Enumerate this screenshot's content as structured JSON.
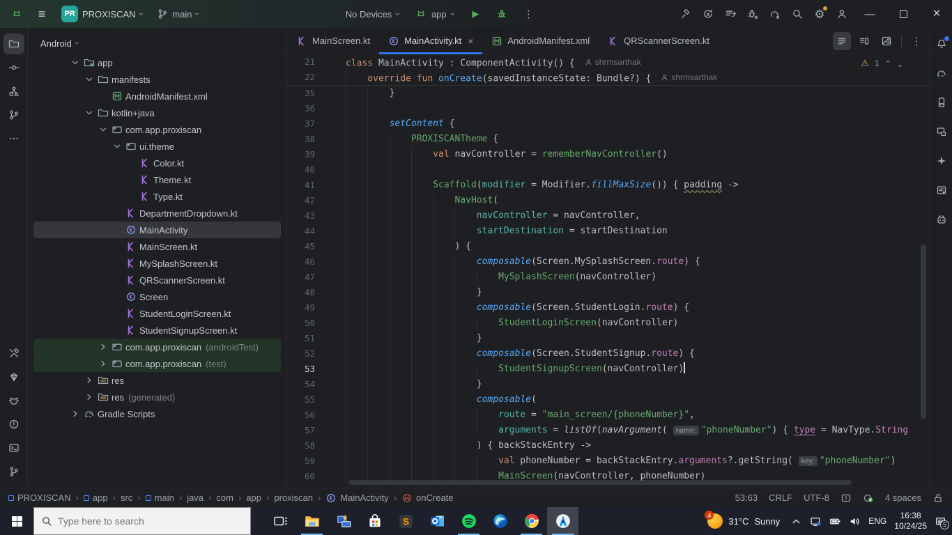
{
  "title_bar": {
    "project_badge": "PR",
    "project_name": "PROXISCAN",
    "branch_name": "main",
    "device_selector": "No Devices",
    "run_config": "app",
    "right_icons": [
      "build",
      "sync",
      "task-list",
      "attach-debugger",
      "gradle-sync",
      "search",
      "settings",
      "account"
    ]
  },
  "left_stripe": {
    "top": [
      {
        "name": "project",
        "selected": true
      },
      {
        "name": "commit"
      },
      {
        "name": "structure"
      },
      {
        "name": "pull-requests"
      },
      {
        "name": "more"
      }
    ],
    "bottom": [
      {
        "name": "build-tools"
      },
      {
        "name": "gemini"
      },
      {
        "name": "logcat"
      },
      {
        "name": "problems"
      },
      {
        "name": "terminal"
      },
      {
        "name": "version-control"
      }
    ]
  },
  "right_stripe": [
    {
      "name": "notifications",
      "badge": true
    },
    {
      "name": "gradle"
    },
    {
      "name": "device-manager"
    },
    {
      "name": "running-devices"
    },
    {
      "name": "gemini-sparkle"
    },
    {
      "name": "assistant"
    },
    {
      "name": "app-insights"
    }
  ],
  "project_panel": {
    "view_selector": "Android",
    "tree": [
      {
        "label": "app",
        "level": 1,
        "chevron": "down",
        "icon": "folder-app"
      },
      {
        "label": "manifests",
        "level": 2,
        "chevron": "down",
        "icon": "folder"
      },
      {
        "label": "AndroidManifest.xml",
        "level": 3,
        "icon": "file-manifest"
      },
      {
        "label": "kotlin+java",
        "level": 2,
        "chevron": "down",
        "icon": "folder"
      },
      {
        "label": "com.app.proxiscan",
        "level": 3,
        "chevron": "down",
        "icon": "package"
      },
      {
        "label": "ui.theme",
        "level": 4,
        "chevron": "down",
        "icon": "package"
      },
      {
        "label": "Color.kt",
        "level": 5,
        "icon": "file-kotlin"
      },
      {
        "label": "Theme.kt",
        "level": 5,
        "icon": "file-kotlin"
      },
      {
        "label": "Type.kt",
        "level": 5,
        "icon": "file-kotlin"
      },
      {
        "label": "DepartmentDropdown.kt",
        "level": 4,
        "icon": "file-kotlin"
      },
      {
        "label": "MainActivity",
        "level": 4,
        "icon": "class-kotlin",
        "selected": true
      },
      {
        "label": "MainScreen.kt",
        "level": 4,
        "icon": "file-kotlin"
      },
      {
        "label": "MySplashScreen.kt",
        "level": 4,
        "icon": "file-kotlin"
      },
      {
        "label": "QRScannerScreen.kt",
        "level": 4,
        "icon": "file-kotlin"
      },
      {
        "label": "Screen",
        "level": 4,
        "icon": "class-kotlin"
      },
      {
        "label": "StudentLoginScreen.kt",
        "level": 4,
        "icon": "file-kotlin"
      },
      {
        "label": "StudentSignupScreen.kt",
        "level": 4,
        "icon": "file-kotlin"
      },
      {
        "label": "com.app.proxiscan",
        "suffix": "(androidTest)",
        "level": 3,
        "chevron": "right",
        "icon": "package",
        "tint": true
      },
      {
        "label": "com.app.proxiscan",
        "suffix": "(test)",
        "level": 3,
        "chevron": "right",
        "icon": "package",
        "tint": true
      },
      {
        "label": "res",
        "level": 2,
        "chevron": "right",
        "icon": "folder-res"
      },
      {
        "label": "res",
        "suffix": "(generated)",
        "level": 2,
        "chevron": "right",
        "icon": "folder-res"
      },
      {
        "label": "Gradle Scripts",
        "level": 1,
        "chevron": "right",
        "icon": "gradle"
      }
    ]
  },
  "editor": {
    "tabs": [
      {
        "label": "MainScreen.kt",
        "icon": "file-kotlin"
      },
      {
        "label": "MainActivity.kt",
        "icon": "class-kotlin",
        "active": true,
        "close": "×"
      },
      {
        "label": "AndroidManifest.xml",
        "icon": "file-manifest"
      },
      {
        "label": "QRScannerScreen.kt",
        "icon": "file-kotlin"
      }
    ],
    "view_modes": [
      "code-view",
      "split-view",
      "design-view"
    ],
    "warning_count": "1",
    "sticky_lines": [
      {
        "n": "21",
        "ind": 0,
        "seg": [
          [
            "k",
            "class "
          ],
          [
            "p",
            "MainActivity : ComponentActivity() {"
          ]
        ],
        "author": "shrmsarthak"
      },
      {
        "n": "22",
        "ind": 4,
        "seg": [
          [
            "k",
            "override fun "
          ],
          [
            "f",
            "onCreate"
          ],
          [
            "p",
            "(savedInstanceState: Bundle?) {"
          ]
        ],
        "author": "shrmsarthak"
      }
    ],
    "lines": [
      {
        "n": "35",
        "ind": 8,
        "seg": [
          [
            "p",
            "}"
          ]
        ]
      },
      {
        "n": "36",
        "ind": 8,
        "seg": []
      },
      {
        "n": "37",
        "ind": 8,
        "seg": [
          [
            "fi",
            "setContent"
          ],
          [
            "p",
            " {"
          ]
        ]
      },
      {
        "n": "38",
        "ind": 12,
        "seg": [
          [
            "g",
            "PROXISCANTheme"
          ],
          [
            "p",
            " {"
          ]
        ]
      },
      {
        "n": "39",
        "ind": 16,
        "seg": [
          [
            "k",
            "val "
          ],
          [
            "p",
            "navController = "
          ],
          [
            "g",
            "rememberNavController"
          ],
          [
            "p",
            "()"
          ]
        ]
      },
      {
        "n": "40",
        "ind": 16,
        "seg": []
      },
      {
        "n": "41",
        "ind": 16,
        "seg": [
          [
            "g",
            "Scaffold"
          ],
          [
            "p",
            "("
          ],
          [
            "a",
            "modifier"
          ],
          [
            "p",
            " = Modifier."
          ],
          [
            "fi",
            "fillMaxSize"
          ],
          [
            "p",
            "()) { "
          ],
          [
            "w",
            "padding"
          ],
          [
            "p",
            " ->"
          ]
        ]
      },
      {
        "n": "42",
        "ind": 20,
        "seg": [
          [
            "g",
            "NavHost"
          ],
          [
            "p",
            "("
          ]
        ]
      },
      {
        "n": "43",
        "ind": 24,
        "seg": [
          [
            "a",
            "navController"
          ],
          [
            "p",
            " = navController,"
          ]
        ]
      },
      {
        "n": "44",
        "ind": 24,
        "seg": [
          [
            "a",
            "startDestination"
          ],
          [
            "p",
            " = startDestination"
          ]
        ]
      },
      {
        "n": "45",
        "ind": 20,
        "seg": [
          [
            "p",
            ") {"
          ]
        ]
      },
      {
        "n": "46",
        "ind": 24,
        "seg": [
          [
            "fi",
            "composable"
          ],
          [
            "p",
            "(Screen.MySplashScreen."
          ],
          [
            "pr",
            "route"
          ],
          [
            "p",
            ") {"
          ]
        ]
      },
      {
        "n": "47",
        "ind": 28,
        "seg": [
          [
            "g",
            "MySplashScreen"
          ],
          [
            "p",
            "(navController)"
          ]
        ]
      },
      {
        "n": "48",
        "ind": 24,
        "seg": [
          [
            "p",
            "}"
          ]
        ]
      },
      {
        "n": "49",
        "ind": 24,
        "seg": [
          [
            "fi",
            "composable"
          ],
          [
            "p",
            "(Screen.StudentLogin."
          ],
          [
            "pr",
            "route"
          ],
          [
            "p",
            ") {"
          ]
        ]
      },
      {
        "n": "50",
        "ind": 28,
        "seg": [
          [
            "g",
            "StudentLoginScreen"
          ],
          [
            "p",
            "(navController)"
          ]
        ]
      },
      {
        "n": "51",
        "ind": 24,
        "seg": [
          [
            "p",
            "}"
          ]
        ]
      },
      {
        "n": "52",
        "ind": 24,
        "seg": [
          [
            "fi",
            "composable"
          ],
          [
            "p",
            "(Screen.StudentSignup."
          ],
          [
            "pr",
            "route"
          ],
          [
            "p",
            ") {"
          ]
        ]
      },
      {
        "n": "53",
        "ind": 28,
        "current": true,
        "seg": [
          [
            "g",
            "StudentSignupScreen"
          ],
          [
            "p",
            "(navController)"
          ],
          [
            "caret",
            ""
          ]
        ]
      },
      {
        "n": "54",
        "ind": 24,
        "seg": [
          [
            "p",
            "}"
          ]
        ]
      },
      {
        "n": "55",
        "ind": 24,
        "seg": [
          [
            "fi",
            "composable"
          ],
          [
            "p",
            "("
          ]
        ]
      },
      {
        "n": "56",
        "ind": 28,
        "seg": [
          [
            "a",
            "route"
          ],
          [
            "p",
            " = "
          ],
          [
            "s",
            "\"main_screen/{phoneNumber}\""
          ],
          [
            "p",
            ","
          ]
        ]
      },
      {
        "n": "57",
        "ind": 28,
        "seg": [
          [
            "a",
            "arguments"
          ],
          [
            "p",
            " = "
          ],
          [
            "pi",
            "listOf"
          ],
          [
            "p",
            "("
          ],
          [
            "pi",
            "navArgument"
          ],
          [
            "p",
            "( "
          ],
          [
            "h",
            "name:"
          ],
          [
            "s",
            "\"phoneNumber\""
          ],
          [
            "p",
            ") { "
          ],
          [
            "pu",
            "type"
          ],
          [
            "p",
            " = NavType."
          ],
          [
            "pr",
            "String"
          ]
        ]
      },
      {
        "n": "58",
        "ind": 24,
        "seg": [
          [
            "p",
            ") { backStackEntry ->"
          ]
        ]
      },
      {
        "n": "59",
        "ind": 28,
        "seg": [
          [
            "k",
            "val "
          ],
          [
            "p",
            "phoneNumber = backStackEntry."
          ],
          [
            "pr",
            "arguments"
          ],
          [
            "p",
            "?.getString( "
          ],
          [
            "h",
            "key:"
          ],
          [
            "s",
            "\"phoneNumber\""
          ],
          [
            "p",
            ")"
          ]
        ]
      },
      {
        "n": "60",
        "ind": 28,
        "seg": [
          [
            "g",
            "MainScreen"
          ],
          [
            "p",
            "(navController, phoneNumber)"
          ]
        ]
      }
    ]
  },
  "status_bar": {
    "breadcrumbs": [
      {
        "label": "PROXISCAN",
        "icon": "module"
      },
      {
        "label": "app",
        "icon": "module"
      },
      {
        "label": "src"
      },
      {
        "label": "main",
        "icon": "module"
      },
      {
        "label": "java"
      },
      {
        "label": "com"
      },
      {
        "label": "app"
      },
      {
        "label": "proxiscan"
      },
      {
        "label": "MainActivity",
        "icon": "class-kotlin"
      },
      {
        "label": "onCreate",
        "icon": "method"
      }
    ],
    "caret_position": "53:63",
    "line_separator": "CRLF",
    "encoding": "UTF-8",
    "indent": "4 spaces"
  },
  "taskbar": {
    "search_placeholder": "Type here to search",
    "apps": [
      {
        "name": "task-view"
      },
      {
        "name": "file-explorer",
        "running": true
      },
      {
        "name": "remote-desktop"
      },
      {
        "name": "microsoft-store"
      },
      {
        "name": "sublime-text"
      },
      {
        "name": "outlook"
      },
      {
        "name": "spotify",
        "running": true
      },
      {
        "name": "edge"
      },
      {
        "name": "chrome",
        "running": true
      },
      {
        "name": "android-studio",
        "running": true,
        "focused": true
      }
    ],
    "tray": {
      "weather_badge": "4",
      "weather_temp": "31°C",
      "weather_condition": "Sunny",
      "language": "ENG",
      "time": "16:38",
      "date": "10/24/25",
      "notification_badge": "5"
    }
  },
  "colors": {
    "accent_blue": "#3574f0",
    "run_green": "#57ad5c",
    "keyword_orange": "#cf8e6d",
    "function_blue": "#56a8f5",
    "string_green": "#6aab73",
    "property_purple": "#c77dbb",
    "named_arg_teal": "#57b5ac",
    "taskbar_underline": "#76b9ed"
  }
}
